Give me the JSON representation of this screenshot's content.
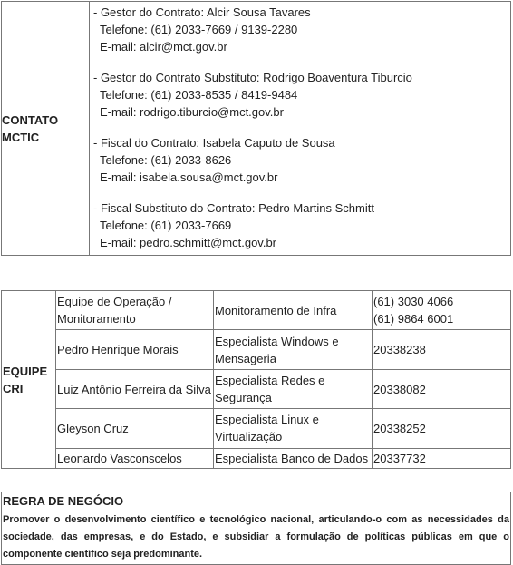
{
  "contato": {
    "label_line1": "CONTATO",
    "label_line2": "MCTIC",
    "contacts": [
      {
        "role": "- Gestor do Contrato: Alcir Sousa Tavares",
        "phone": "Telefone: (61) 2033-7669 / 9139-2280",
        "email": "E-mail: alcir@mct.gov.br"
      },
      {
        "role": "- Gestor do Contrato Substituto: Rodrigo Boaventura Tiburcio",
        "phone": "Telefone: (61) 2033-8535 / 8419-9484",
        "email": "E-mail: rodrigo.tiburcio@mct.gov.br"
      },
      {
        "role": "- Fiscal do Contrato: Isabela Caputo de Sousa",
        "phone": "Telefone: (61) 2033-8626",
        "email": "E-mail: isabela.sousa@mct.gov.br"
      },
      {
        "role": "- Fiscal Substituto do Contrato: Pedro Martins Schmitt",
        "phone": "Telefone: (61) 2033-7669",
        "email": "E-mail: pedro.schmitt@mct.gov.br"
      }
    ]
  },
  "equipe": {
    "label_line1": "EQUIPE",
    "label_line2": "CRI",
    "rows": [
      {
        "name": "Equipe de Operação / Monitoramento",
        "role": "Monitoramento de Infra",
        "phone": "(61) 3030 4066",
        "phone2": "(61) 9864 6001"
      },
      {
        "name": "Pedro Henrique Morais",
        "role": "Especialista Windows e Mensageria",
        "phone": "20338238"
      },
      {
        "name": "Luiz Antônio Ferreira da Silva",
        "role": "Especialista Redes e Segurança",
        "phone": "20338082"
      },
      {
        "name": "Gleyson Cruz",
        "role": "Especialista Linux e Virtualização",
        "phone": "20338252"
      },
      {
        "name": "Leonardo Vasconscelos",
        "role": "Especialista Banco de Dados",
        "phone": "20337732"
      }
    ]
  },
  "regra": {
    "heading": "REGRA DE NEGÓCIO",
    "text": "Promover o desenvolvimento científico e tecnológico nacional, articulando-o com as necessidades da sociedade, das empresas, e do Estado, e subsidiar a formulação de políticas públicas em que o componente científico seja predominante."
  }
}
